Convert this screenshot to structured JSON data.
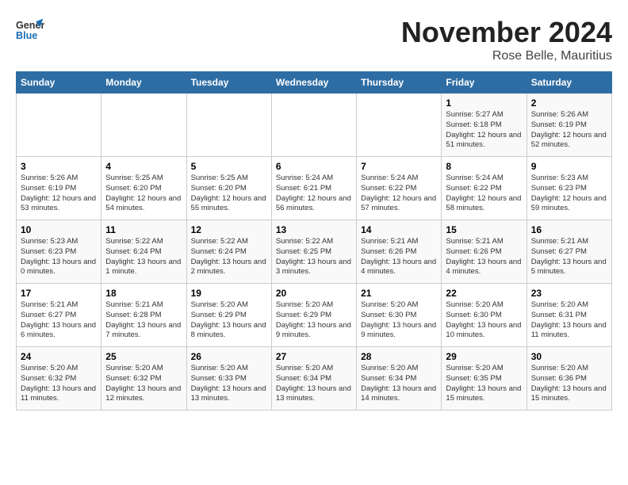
{
  "header": {
    "logo_line1": "General",
    "logo_line2": "Blue",
    "month": "November 2024",
    "location": "Rose Belle, Mauritius"
  },
  "days_of_week": [
    "Sunday",
    "Monday",
    "Tuesday",
    "Wednesday",
    "Thursday",
    "Friday",
    "Saturday"
  ],
  "weeks": [
    [
      {
        "day": "",
        "detail": ""
      },
      {
        "day": "",
        "detail": ""
      },
      {
        "day": "",
        "detail": ""
      },
      {
        "day": "",
        "detail": ""
      },
      {
        "day": "",
        "detail": ""
      },
      {
        "day": "1",
        "detail": "Sunrise: 5:27 AM\nSunset: 6:18 PM\nDaylight: 12 hours and 51 minutes."
      },
      {
        "day": "2",
        "detail": "Sunrise: 5:26 AM\nSunset: 6:19 PM\nDaylight: 12 hours and 52 minutes."
      }
    ],
    [
      {
        "day": "3",
        "detail": "Sunrise: 5:26 AM\nSunset: 6:19 PM\nDaylight: 12 hours and 53 minutes."
      },
      {
        "day": "4",
        "detail": "Sunrise: 5:25 AM\nSunset: 6:20 PM\nDaylight: 12 hours and 54 minutes."
      },
      {
        "day": "5",
        "detail": "Sunrise: 5:25 AM\nSunset: 6:20 PM\nDaylight: 12 hours and 55 minutes."
      },
      {
        "day": "6",
        "detail": "Sunrise: 5:24 AM\nSunset: 6:21 PM\nDaylight: 12 hours and 56 minutes."
      },
      {
        "day": "7",
        "detail": "Sunrise: 5:24 AM\nSunset: 6:22 PM\nDaylight: 12 hours and 57 minutes."
      },
      {
        "day": "8",
        "detail": "Sunrise: 5:24 AM\nSunset: 6:22 PM\nDaylight: 12 hours and 58 minutes."
      },
      {
        "day": "9",
        "detail": "Sunrise: 5:23 AM\nSunset: 6:23 PM\nDaylight: 12 hours and 59 minutes."
      }
    ],
    [
      {
        "day": "10",
        "detail": "Sunrise: 5:23 AM\nSunset: 6:23 PM\nDaylight: 13 hours and 0 minutes."
      },
      {
        "day": "11",
        "detail": "Sunrise: 5:22 AM\nSunset: 6:24 PM\nDaylight: 13 hours and 1 minute."
      },
      {
        "day": "12",
        "detail": "Sunrise: 5:22 AM\nSunset: 6:24 PM\nDaylight: 13 hours and 2 minutes."
      },
      {
        "day": "13",
        "detail": "Sunrise: 5:22 AM\nSunset: 6:25 PM\nDaylight: 13 hours and 3 minutes."
      },
      {
        "day": "14",
        "detail": "Sunrise: 5:21 AM\nSunset: 6:26 PM\nDaylight: 13 hours and 4 minutes."
      },
      {
        "day": "15",
        "detail": "Sunrise: 5:21 AM\nSunset: 6:26 PM\nDaylight: 13 hours and 4 minutes."
      },
      {
        "day": "16",
        "detail": "Sunrise: 5:21 AM\nSunset: 6:27 PM\nDaylight: 13 hours and 5 minutes."
      }
    ],
    [
      {
        "day": "17",
        "detail": "Sunrise: 5:21 AM\nSunset: 6:27 PM\nDaylight: 13 hours and 6 minutes."
      },
      {
        "day": "18",
        "detail": "Sunrise: 5:21 AM\nSunset: 6:28 PM\nDaylight: 13 hours and 7 minutes."
      },
      {
        "day": "19",
        "detail": "Sunrise: 5:20 AM\nSunset: 6:29 PM\nDaylight: 13 hours and 8 minutes."
      },
      {
        "day": "20",
        "detail": "Sunrise: 5:20 AM\nSunset: 6:29 PM\nDaylight: 13 hours and 9 minutes."
      },
      {
        "day": "21",
        "detail": "Sunrise: 5:20 AM\nSunset: 6:30 PM\nDaylight: 13 hours and 9 minutes."
      },
      {
        "day": "22",
        "detail": "Sunrise: 5:20 AM\nSunset: 6:30 PM\nDaylight: 13 hours and 10 minutes."
      },
      {
        "day": "23",
        "detail": "Sunrise: 5:20 AM\nSunset: 6:31 PM\nDaylight: 13 hours and 11 minutes."
      }
    ],
    [
      {
        "day": "24",
        "detail": "Sunrise: 5:20 AM\nSunset: 6:32 PM\nDaylight: 13 hours and 11 minutes."
      },
      {
        "day": "25",
        "detail": "Sunrise: 5:20 AM\nSunset: 6:32 PM\nDaylight: 13 hours and 12 minutes."
      },
      {
        "day": "26",
        "detail": "Sunrise: 5:20 AM\nSunset: 6:33 PM\nDaylight: 13 hours and 13 minutes."
      },
      {
        "day": "27",
        "detail": "Sunrise: 5:20 AM\nSunset: 6:34 PM\nDaylight: 13 hours and 13 minutes."
      },
      {
        "day": "28",
        "detail": "Sunrise: 5:20 AM\nSunset: 6:34 PM\nDaylight: 13 hours and 14 minutes."
      },
      {
        "day": "29",
        "detail": "Sunrise: 5:20 AM\nSunset: 6:35 PM\nDaylight: 13 hours and 15 minutes."
      },
      {
        "day": "30",
        "detail": "Sunrise: 5:20 AM\nSunset: 6:36 PM\nDaylight: 13 hours and 15 minutes."
      }
    ]
  ]
}
